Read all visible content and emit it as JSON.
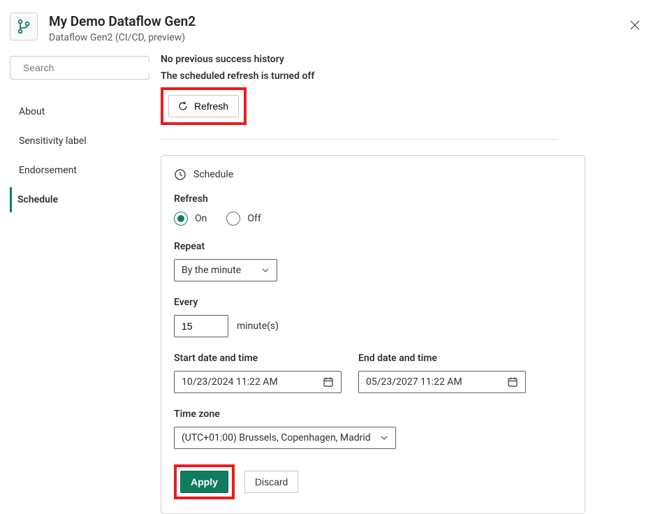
{
  "header": {
    "title": "My Demo Dataflow Gen2",
    "subtitle": "Dataflow Gen2 (CI/CD, preview)"
  },
  "search": {
    "placeholder": "Search"
  },
  "nav": {
    "about": "About",
    "sensitivity": "Sensitivity label",
    "endorsement": "Endorsement",
    "schedule": "Schedule"
  },
  "messages": {
    "no_history": "No previous success history",
    "refresh_off": "The scheduled refresh is turned off"
  },
  "refresh_button": "Refresh",
  "schedule_card": {
    "title": "Schedule",
    "refresh_label": "Refresh",
    "on_label": "On",
    "off_label": "Off",
    "refresh_value": "On",
    "repeat_label": "Repeat",
    "repeat_value": "By the minute",
    "every_label": "Every",
    "every_value": "15",
    "every_unit": "minute(s)",
    "start_label": "Start date and time",
    "start_value": "10/23/2024 11:22 AM",
    "end_label": "End date and time",
    "end_value": "05/23/2027 11:22 AM",
    "timezone_label": "Time zone",
    "timezone_value": "(UTC+01:00) Brussels, Copenhagen, Madrid",
    "apply_label": "Apply",
    "discard_label": "Discard"
  },
  "highlights": {
    "color": "#ea1c1c"
  }
}
